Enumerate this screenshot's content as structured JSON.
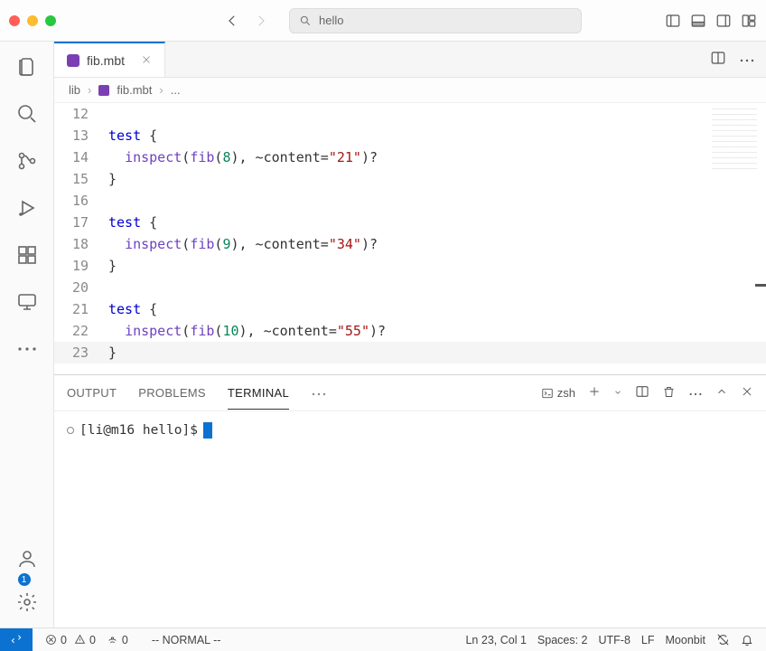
{
  "window": {
    "traffic": {
      "close": "#ff5f57",
      "min": "#febc2e",
      "max": "#28c840"
    },
    "search_text": "hello"
  },
  "tab": {
    "filename": "fib.mbt"
  },
  "breadcrumbs": {
    "root": "lib",
    "file": "fib.mbt",
    "tail": "..."
  },
  "editor": {
    "lines": [
      {
        "n": 12,
        "segs": []
      },
      {
        "n": 13,
        "segs": [
          {
            "t": "test",
            "c": "kw-test"
          },
          {
            "t": " {",
            "c": "brace"
          }
        ]
      },
      {
        "n": 14,
        "segs": [
          {
            "t": "  ",
            "c": ""
          },
          {
            "t": "inspect",
            "c": "fn"
          },
          {
            "t": "(",
            "c": "punct"
          },
          {
            "t": "fib",
            "c": "fib"
          },
          {
            "t": "(",
            "c": "punct"
          },
          {
            "t": "8",
            "c": "num"
          },
          {
            "t": "), ~content=",
            "c": "punct"
          },
          {
            "t": "\"21\"",
            "c": "str"
          },
          {
            "t": ")?",
            "c": "punct"
          }
        ]
      },
      {
        "n": 15,
        "segs": [
          {
            "t": "}",
            "c": "brace"
          }
        ]
      },
      {
        "n": 16,
        "segs": []
      },
      {
        "n": 17,
        "segs": [
          {
            "t": "test",
            "c": "kw-test"
          },
          {
            "t": " {",
            "c": "brace"
          }
        ]
      },
      {
        "n": 18,
        "segs": [
          {
            "t": "  ",
            "c": ""
          },
          {
            "t": "inspect",
            "c": "fn"
          },
          {
            "t": "(",
            "c": "punct"
          },
          {
            "t": "fib",
            "c": "fib"
          },
          {
            "t": "(",
            "c": "punct"
          },
          {
            "t": "9",
            "c": "num"
          },
          {
            "t": "), ~content=",
            "c": "punct"
          },
          {
            "t": "\"34\"",
            "c": "str"
          },
          {
            "t": ")?",
            "c": "punct"
          }
        ]
      },
      {
        "n": 19,
        "segs": [
          {
            "t": "}",
            "c": "brace"
          }
        ]
      },
      {
        "n": 20,
        "segs": []
      },
      {
        "n": 21,
        "segs": [
          {
            "t": "test",
            "c": "kw-test"
          },
          {
            "t": " {",
            "c": "brace"
          }
        ]
      },
      {
        "n": 22,
        "segs": [
          {
            "t": "  ",
            "c": ""
          },
          {
            "t": "inspect",
            "c": "fn"
          },
          {
            "t": "(",
            "c": "punct"
          },
          {
            "t": "fib",
            "c": "fib"
          },
          {
            "t": "(",
            "c": "punct"
          },
          {
            "t": "10",
            "c": "num"
          },
          {
            "t": "), ~content=",
            "c": "punct"
          },
          {
            "t": "\"55\"",
            "c": "str"
          },
          {
            "t": ")?",
            "c": "punct"
          }
        ]
      },
      {
        "n": 23,
        "segs": [
          {
            "t": "}",
            "c": "brace"
          }
        ],
        "hl": true
      }
    ]
  },
  "panel": {
    "tabs": {
      "output": "OUTPUT",
      "problems": "PROBLEMS",
      "terminal": "TERMINAL"
    },
    "shell": "zsh",
    "prompt": "[li@m16 hello]$ "
  },
  "status": {
    "errors": "0",
    "warnings": "0",
    "ports": "0",
    "mode": "-- NORMAL --",
    "cursor": "Ln 23, Col 1",
    "spaces": "Spaces: 2",
    "encoding": "UTF-8",
    "eol": "LF",
    "lang": "Moonbit"
  },
  "activity_badge": "1"
}
